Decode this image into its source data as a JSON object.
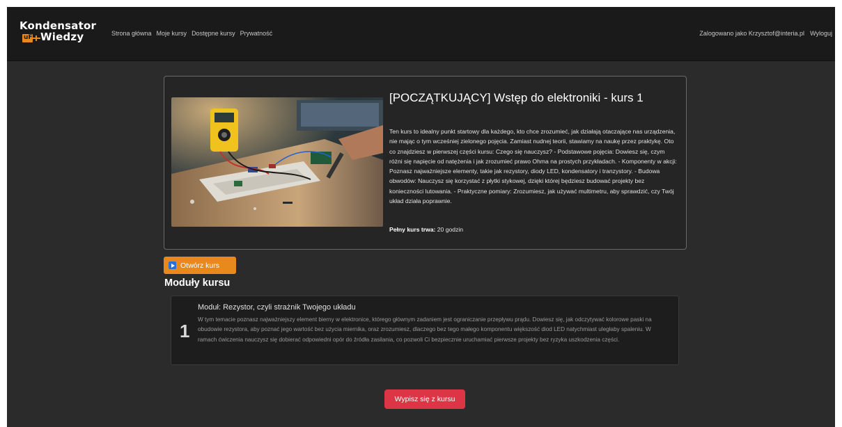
{
  "brand": {
    "line1": "Kondensator",
    "line2": "Wiedzy",
    "badge": "uF"
  },
  "nav": {
    "links": [
      "Strona główna",
      "Moje kursy",
      "Dostępne kursy",
      "Prywatność"
    ],
    "user_label": "Zalogowano jako Krzysztof@interia.pl",
    "logout": "Wyloguj"
  },
  "course": {
    "title": "[POCZĄTKUJĄCY] Wstęp do elektroniki - kurs 1",
    "description": "Ten kurs to idealny punkt startowy dla każdego, kto chce zrozumieć, jak działają otaczające nas urządzenia, nie mając o tym wcześniej zielonego pojęcia. Zamiast nudnej teorii, stawiamy na naukę przez praktykę. Oto co znajdziesz w pierwszej części kursu: Czego się nauczysz? - Podstawowe pojęcia: Dowiesz się, czym różni się napięcie od natężenia i jak zrozumieć prawo Ohma na prostych przykładach. - Komponenty w akcji: Poznasz najważniejsze elementy, takie jak rezystory, diody LED, kondensatory i tranzystory. - Budowa obwodów: Nauczysz się korzystać z płytki stykowej, dzięki której będziesz budować projekty bez konieczności lutowania. - Praktyczne pomiary: Zrozumiesz, jak używać multimetru, aby sprawdzić, czy Twój układ działa poprawnie.",
    "duration_label": "Pełny kurs trwa:",
    "duration_value": "20 godzin",
    "open_button": "Otwórz kurs"
  },
  "modules": {
    "heading": "Moduły kursu",
    "items": [
      {
        "number": "1",
        "title": "Moduł: Rezystor, czyli strażnik Twojego układu",
        "description": "W tym temacie poznasz najważniejszy element bierny w elektronice, którego głównym zadaniem jest ograniczanie przepływu prądu. Dowiesz się, jak odczytywać kolorowe paski na obudowie rezystora, aby poznać jego wartość bez użycia miernika, oraz zrozumiesz, dlaczego bez tego małego komponentu większość diod LED natychmiast uległaby spaleniu. W ramach ćwiczenia nauczysz się dobierać odpowiedni opór do źródła zasilania, co pozwoli Ci bezpiecznie uruchamiać pierwsze projekty bez ryzyka uszkodzenia części."
      }
    ]
  },
  "actions": {
    "unenroll": "Wypisz się z kursu"
  },
  "colors": {
    "background": "#2b2b2b",
    "navbar": "#1a1a1a",
    "accent_orange": "#e8891c",
    "danger_red": "#dc3545"
  }
}
